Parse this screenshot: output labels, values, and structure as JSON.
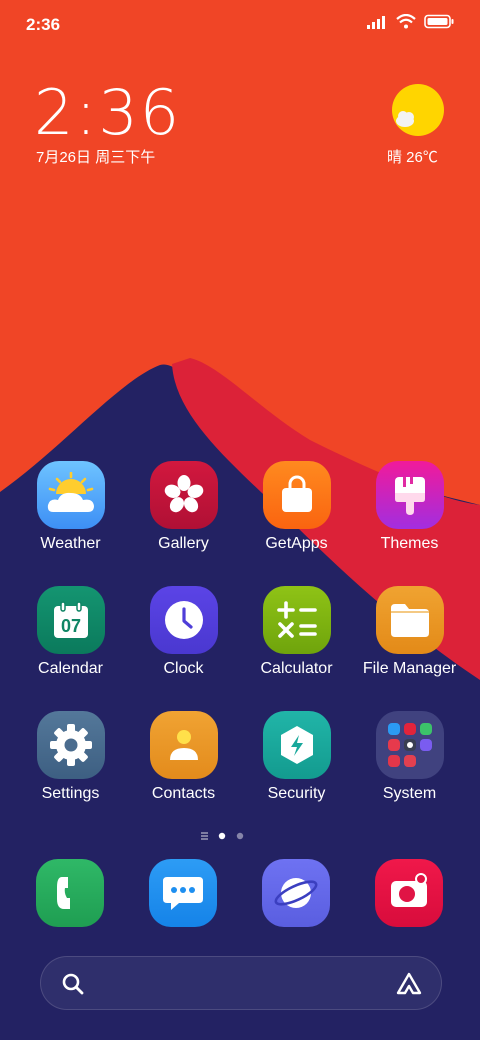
{
  "status_bar": {
    "time": "2:36"
  },
  "lock_widget": {
    "time": "2:36",
    "date": "7月26日 周三下午",
    "weather": "晴 26℃"
  },
  "apps": [
    {
      "label": "Weather",
      "icon": "weather-icon"
    },
    {
      "label": "Gallery",
      "icon": "gallery-icon"
    },
    {
      "label": "GetApps",
      "icon": "getapps-icon"
    },
    {
      "label": "Themes",
      "icon": "themes-icon"
    },
    {
      "label": "Calendar",
      "icon": "calendar-icon",
      "day": "07"
    },
    {
      "label": "Clock",
      "icon": "clock-icon"
    },
    {
      "label": "Calculator",
      "icon": "calculator-icon"
    },
    {
      "label": "File Manager",
      "icon": "folder-icon"
    },
    {
      "label": "Settings",
      "icon": "gear-icon"
    },
    {
      "label": "Contacts",
      "icon": "contacts-icon"
    },
    {
      "label": "Security",
      "icon": "security-icon"
    },
    {
      "label": "System",
      "icon": "system-folder-icon"
    }
  ],
  "dock": [
    "phone-icon",
    "messages-icon",
    "browser-icon",
    "camera-icon"
  ],
  "page_indicator": {
    "pages": 2,
    "current": 1
  },
  "colors": {
    "sky": "#f04526",
    "mountain": "#dc2238",
    "ground": "#232263"
  }
}
